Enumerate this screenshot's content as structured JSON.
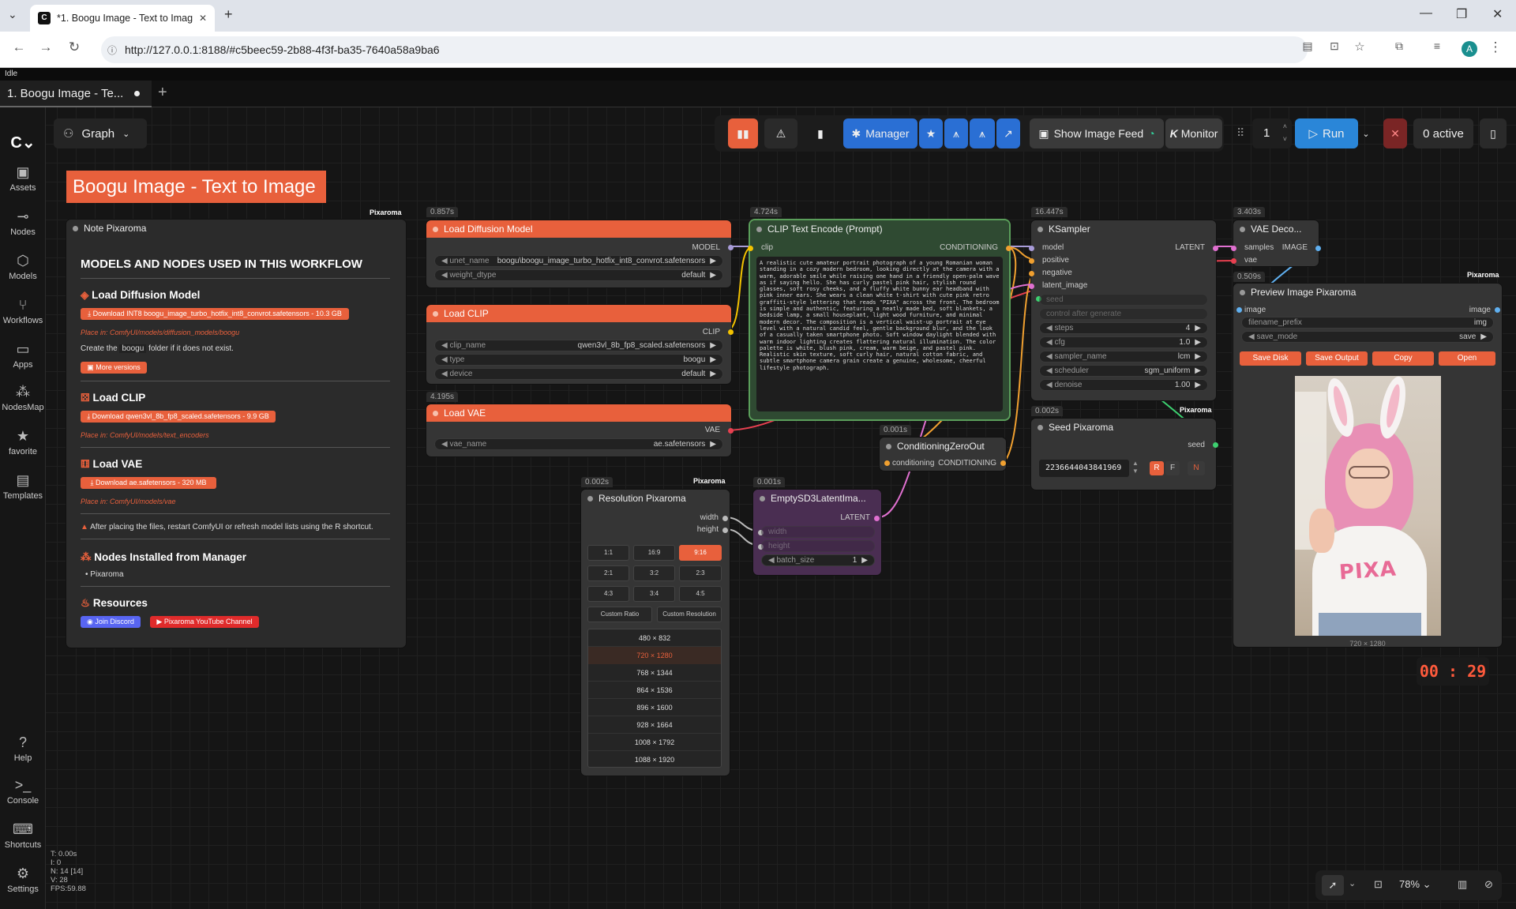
{
  "browser": {
    "tab_title": "*1. Boogu Image - Text to Imag",
    "url": "http://127.0.0.1:8188/#c5beec59-2b88-4f3f-ba35-7640a58a9ba6",
    "avatar": "A"
  },
  "app": {
    "status": "Idle",
    "workflow_tab": "1. Boogu Image - Te...",
    "graph_label": "Graph",
    "title_banner": "Boogu Image - Text to Image"
  },
  "sidebar": {
    "items": [
      "Assets",
      "Nodes",
      "Models",
      "Workflows",
      "Apps",
      "NodesMap",
      "favorite",
      "Templates"
    ],
    "bottom": [
      "Help",
      "Console",
      "Shortcuts",
      "Settings"
    ]
  },
  "toolbar": {
    "manager": "Manager",
    "show_image_feed": "Show Image Feed",
    "monitor": "Monitor",
    "queue_count": "1",
    "run": "Run",
    "active": "0 active"
  },
  "note": {
    "tag": "Pixaroma",
    "title": "Note Pixaroma",
    "heading": "MODELS AND NODES USED IN THIS WORKFLOW",
    "load_diffusion": "Load Diffusion Model",
    "dl_diffusion": "Download INT8 boogu_image_turbo_hotfix_int8_convrot.safetensors - 10.3 GB",
    "place_diffusion": "Place in: ComfyUI/models/diffusion_models/boogu",
    "create_folder_a": "Create the",
    "create_folder_b": "boogu",
    "create_folder_c": "folder if it does not exist.",
    "more_versions": "More versions",
    "load_clip": "Load CLIP",
    "dl_clip": "Download qwen3vl_8b_fp8_scaled.safetensors - 9.9 GB",
    "place_clip": "Place in: ComfyUI/models/text_encoders",
    "load_vae": "Load VAE",
    "dl_vae": "Download ae.safetensors - 320 MB",
    "place_vae": "Place in: ComfyUI/models/vae",
    "warning": "After placing the files, restart ComfyUI or refresh model lists using the R shortcut.",
    "nodes_installed": "Nodes Installed from Manager",
    "nodes_item": "Pixaroma",
    "resources": "Resources",
    "discord": "Join Discord",
    "youtube": "Pixaroma YouTube Channel"
  },
  "load_diffusion": {
    "time": "0.857s",
    "title": "Load Diffusion Model",
    "out": "MODEL",
    "unet_name_label": "unet_name",
    "unet_name": "boogu\\boogu_image_turbo_hotfix_int8_convrot.safetensors",
    "weight_dtype_label": "weight_dtype",
    "weight_dtype": "default"
  },
  "load_clip": {
    "title": "Load CLIP",
    "out": "CLIP",
    "clip_name_label": "clip_name",
    "clip_name": "qwen3vl_8b_fp8_scaled.safetensors",
    "type_label": "type",
    "type": "boogu",
    "device_label": "device",
    "device": "default"
  },
  "load_vae": {
    "time": "4.195s",
    "title": "Load VAE",
    "out": "VAE",
    "vae_name_label": "vae_name",
    "vae_name": "ae.safetensors"
  },
  "clip_encode": {
    "time": "4.724s",
    "title": "CLIP Text Encode (Prompt)",
    "in": "clip",
    "out": "CONDITIONING",
    "text": "A realistic cute amateur portrait photograph of a young Romanian woman standing in a cozy modern bedroom, looking directly at the camera with a warm, adorable smile while raising one hand in a friendly open-palm wave as if saying hello. She has curly pastel pink hair, stylish round glasses, soft rosy cheeks, and a fluffy white bunny ear headband with pink inner ears. She wears a clean white t-shirt with cute pink retro graffiti-style lettering that reads \"PIXA\" across the front. The bedroom is simple and authentic, featuring a neatly made bed, soft blankets, a bedside lamp, a small houseplant, light wood furniture, and minimal modern decor. The composition is a vertical waist-up portrait at eye level with a natural candid feel, gentle background blur, and the look of a casually taken smartphone photo. Soft window daylight blended with warm indoor lighting creates flattering natural illumination. The color palette is white, blush pink, cream, warm beige, and pastel pink. Realistic skin texture, soft curly hair, natural cotton fabric, and subtle smartphone camera grain create a genuine, wholesome, cheerful lifestyle photograph."
  },
  "ksampler": {
    "time": "16.447s",
    "title": "KSampler",
    "inputs": [
      "model",
      "positive",
      "negative",
      "latent_image"
    ],
    "out": "LATENT",
    "seed_label": "seed",
    "control": "control after generate",
    "widgets": [
      {
        "label": "steps",
        "value": "4"
      },
      {
        "label": "cfg",
        "value": "1.0"
      },
      {
        "label": "sampler_name",
        "value": "lcm"
      },
      {
        "label": "scheduler",
        "value": "sgm_uniform"
      },
      {
        "label": "denoise",
        "value": "1.00"
      }
    ]
  },
  "vae_decode": {
    "time": "3.403s",
    "title": "VAE Deco...",
    "in_samples": "samples",
    "in_vae": "vae",
    "out": "IMAGE"
  },
  "preview": {
    "time": "0.509s",
    "tag": "Pixaroma",
    "title": "Preview Image Pixaroma",
    "in": "image",
    "out": "image",
    "filename_prefix_label": "filename_prefix",
    "filename_prefix": "img",
    "save_mode_label": "save_mode",
    "save_mode": "save",
    "buttons": [
      "Save Disk",
      "Save Output",
      "Copy",
      "Open"
    ],
    "image_size": "720 × 1280",
    "image_text": "PIXA"
  },
  "cond_zero": {
    "time": "0.001s",
    "title": "ConditioningZeroOut",
    "in": "conditioning",
    "out": "CONDITIONING"
  },
  "seed": {
    "time": "0.002s",
    "tag": "Pixaroma",
    "title": "Seed Pixaroma",
    "out": "seed",
    "value": "223664404384196​9",
    "r": "R",
    "f": "F",
    "n": "N"
  },
  "resolution": {
    "time": "0.002s",
    "tag": "Pixaroma",
    "title": "Resolution Pixaroma",
    "out_w": "width",
    "out_h": "height",
    "ratios": [
      "1:1",
      "16:9",
      "9:16",
      "2:1",
      "3:2",
      "2:3",
      "4:3",
      "3:4",
      "4:5"
    ],
    "custom_ratio": "Custom Ratio",
    "custom_res": "Custom Resolution",
    "sizes": [
      "480 × 832",
      "720 × 1280",
      "768 × 1344",
      "864 × 1536",
      "896 × 1600",
      "928 × 1664",
      "1008 × 1792",
      "1088 × 1920"
    ]
  },
  "empty_latent": {
    "time": "0.001s",
    "title": "EmptySD3LatentIma...",
    "out": "LATENT",
    "width": "width",
    "height": "height",
    "batch_label": "batch_size",
    "batch": "1"
  },
  "timer": {
    "min": "00",
    "sec": "29"
  },
  "stats": {
    "t": "T: 0.00s",
    "i": "I: 0",
    "n": "N: 14 [14]",
    "v": "V: 28",
    "fps": "FPS:59.88"
  },
  "bottom": {
    "zoom": "78%"
  }
}
